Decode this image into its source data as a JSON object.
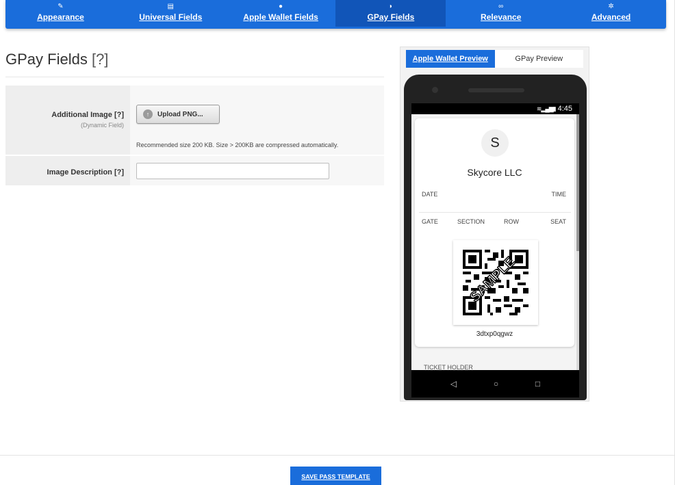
{
  "nav": {
    "tabs": [
      {
        "label": "Appearance",
        "icon": "magic-wand-icon",
        "glyph": "✎",
        "active": false
      },
      {
        "label": "Universal Fields",
        "icon": "document-icon",
        "glyph": "▤",
        "active": false
      },
      {
        "label": "Apple Wallet Fields",
        "icon": "apple-icon",
        "glyph": "●",
        "active": false
      },
      {
        "label": "GPay Fields",
        "icon": "gpay-icon",
        "glyph": "◗",
        "active": true
      },
      {
        "label": "Relevance",
        "icon": "link-icon",
        "glyph": "∞",
        "active": false
      },
      {
        "label": "Advanced",
        "icon": "gears-icon",
        "glyph": "✲",
        "active": false
      }
    ]
  },
  "page": {
    "title": "GPay Fields",
    "help": "[?]"
  },
  "form": {
    "additional_image": {
      "label": "Additional Image",
      "help": "[?]",
      "sublabel": "(Dynamic Field)",
      "button": "Upload PNG...",
      "note": "Recommended size 200 KB. Size > 200KB are compressed automatically."
    },
    "image_description": {
      "label": "Image Description",
      "help": "[?]",
      "value": ""
    }
  },
  "preview": {
    "tab_apple": "Apple Wallet Preview",
    "tab_gpay": "GPay Preview",
    "status_time": "4:45",
    "avatar_letter": "S",
    "company": "Skycore LLC",
    "date_label": "DATE",
    "time_label": "TIME",
    "gate_label": "GATE",
    "section_label": "SECTION",
    "row_label": "ROW",
    "seat_label": "SEAT",
    "qr_watermark": "SAMPLE",
    "barcode_text": "3dtxp0qgwz",
    "holder_label": "TICKET HOLDER"
  },
  "footer": {
    "save_label": "SAVE PASS TEMPLATE"
  },
  "colors": {
    "accent": "#1a6ddb",
    "accent_active": "#1155b8"
  }
}
